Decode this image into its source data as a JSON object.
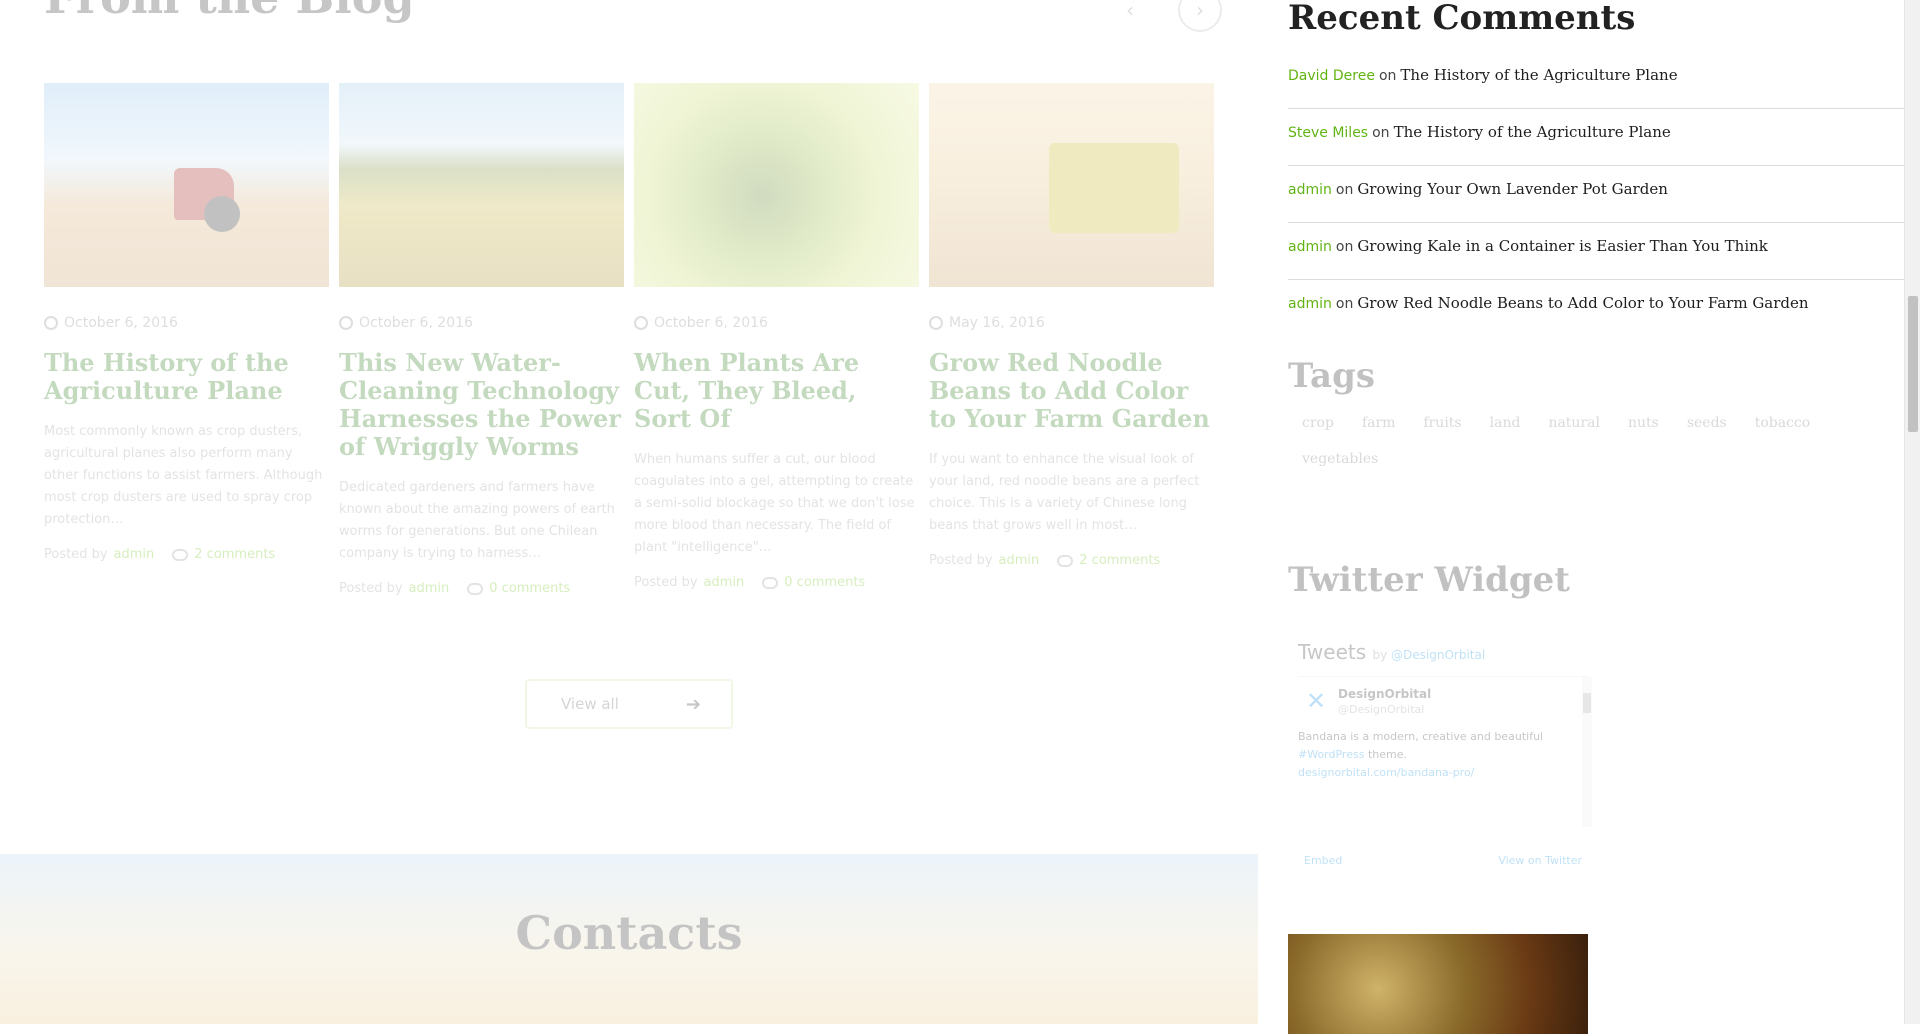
{
  "blog": {
    "heading": "From the Blog",
    "prev_arrow": "‹",
    "next_arrow": "›",
    "cards": [
      {
        "date": "October 6, 2016",
        "title": "The History of the Agriculture Plane",
        "excerpt": "Most commonly known as crop dusters, agricultural planes also perform many other functions to assist farmers. Although most crop dusters are used to spray crop protection…",
        "posted_by": "Posted by",
        "author": "admin",
        "comments": "2 comments"
      },
      {
        "date": "October 6, 2016",
        "title": "This New Water-Cleaning Technology Harnesses the Power of Wriggly Worms",
        "excerpt": "Dedicated gardeners and farmers have known about the amazing powers of earth worms for generations. But one Chilean company is trying to harness…",
        "posted_by": "Posted by",
        "author": "admin",
        "comments": "0 comments"
      },
      {
        "date": "October 6, 2016",
        "title": "When Plants Are Cut, They Bleed, Sort Of",
        "excerpt": "When humans suffer a cut, our blood coagulates into a gel, attempting to create a semi-solid blockage so that we don't lose more blood than necessary. The field of plant \"intelligence\"…",
        "posted_by": "Posted by",
        "author": "admin",
        "comments": "0 comments"
      },
      {
        "date": "May 16, 2016",
        "title": "Grow Red Noodle Beans to Add Color to Your Farm Garden",
        "excerpt": "If you want to enhance the visual look of your land, red noodle beans are a perfect choice. This is a variety of Chinese long beans that grows well in most…",
        "posted_by": "Posted by",
        "author": "admin",
        "comments": "2 comments"
      }
    ],
    "view_all": "View all",
    "view_all_arrow": "➔"
  },
  "contacts": {
    "title": "Contacts"
  },
  "sidebar": {
    "recent_comments": {
      "title": "Recent Comments",
      "connector": "on",
      "items": [
        {
          "author": "David Deree",
          "post": "The History of the Agriculture Plane"
        },
        {
          "author": "Steve Miles",
          "post": "The History of the Agriculture Plane"
        },
        {
          "author": "admin",
          "post": "Growing Your Own Lavender Pot Garden"
        },
        {
          "author": "admin",
          "post": "Growing Kale in a Container is Easier Than You Think"
        },
        {
          "author": "admin",
          "post": "Grow Red Noodle Beans to Add Color to Your Farm Garden"
        }
      ]
    },
    "tags": {
      "title": "Tags",
      "items": [
        "crop",
        "farm",
        "fruits",
        "land",
        "natural",
        "nuts",
        "seeds",
        "tobacco",
        "vegetables"
      ]
    },
    "twitter": {
      "title": "Twitter Widget",
      "tweets_label": "Tweets",
      "by_label": "by",
      "handle": "@DesignOrbital",
      "user_name": "DesignOrbital",
      "user_handle": "@DesignOrbital",
      "tweet_text": "Bandana is a modern, creative and beautiful",
      "tweet_link": "#WordPress",
      "tweet_text_2": "theme.",
      "tweet_url": "designorbital.com/bandana-pro/",
      "embed": "Embed",
      "view_on_twitter": "View on Twitter"
    }
  },
  "colors": {
    "accent_green": "#62b414",
    "link_blue": "#1b95e0"
  }
}
